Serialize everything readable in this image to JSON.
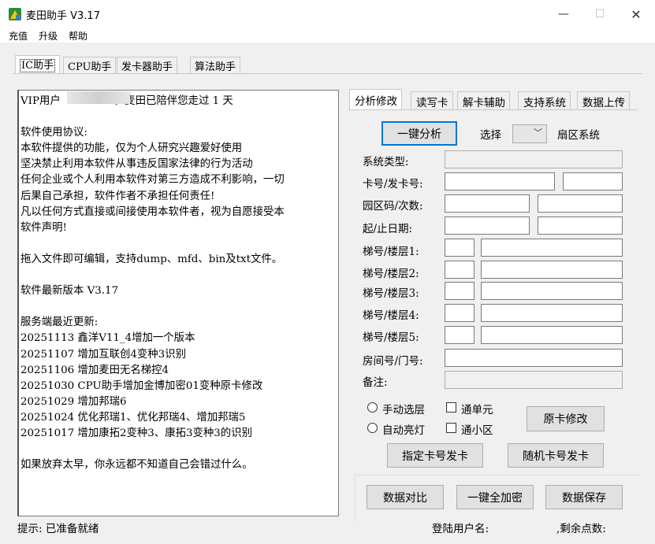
{
  "window": {
    "title": "麦田助手 V3.17",
    "minimize": "—",
    "maximize": "☐",
    "close": "✕"
  },
  "menu": [
    "充值",
    "升级",
    "帮助"
  ],
  "tabs": [
    "IC助手",
    "CPU助手",
    "发卡器助手",
    "算法助手"
  ],
  "info_lines": [
    "VIP用户                ，麦田已陪伴您走过 1 天",
    "",
    "软件使用协议:",
    "本软件提供的功能，仅为个人研究兴趣爱好使用",
    "坚决禁止利用本软件从事违反国家法律的行为活动",
    "任何企业或个人利用本软件对第三方造成不利影响，一切",
    "后果自己承担，软件作者不承担任何责任!",
    "凡以任何方式直接或间接使用本软件者，视为自愿接受本",
    "软件声明!",
    "",
    "拖入文件即可编辑，支持dump、mfd、bin及txt文件。",
    "",
    "软件最新版本 V3.17",
    "",
    "服务端最近更新:",
    "20251113 鑫洋V11_4增加一个版本",
    "20251107 增加互联创4变种3识别",
    "20251106 增加麦田无名梯控4",
    "20251030 CPU助手增加金博加密01变种原卡修改",
    "20251029 增加邦瑞6",
    "20251024 优化邦瑞1、优化邦瑞4、增加邦瑞5",
    "20251017 增加康拓2变种3、康拓3变种3的识别",
    "",
    "如果放弃太早，你永远都不知道自己会错过什么。"
  ],
  "subtabs": [
    "分析修改",
    "读写卡",
    "解卡辅助",
    "支持系统",
    "数据上传"
  ],
  "analysis": {
    "one_click": "一键分析",
    "select_label": "选择",
    "sector_label": "扇区系统",
    "fields": {
      "system_type": "系统类型:",
      "card_no": "卡号/发卡号:",
      "park_code": "园区码/次数:",
      "date_range": "起/止日期:",
      "floor1": "梯号/楼层1:",
      "floor2": "梯号/楼层2:",
      "floor3": "梯号/楼层3:",
      "floor4": "梯号/楼层4:",
      "floor5": "梯号/楼层5:",
      "room": "房间号/门号:",
      "remark": "备注:"
    },
    "radio_manual": "手动选层",
    "radio_auto": "自动亮灯",
    "check_single": "通单元",
    "check_district": "通小区",
    "btn_modify": "原卡修改",
    "btn_assign": "指定卡号发卡",
    "btn_random": "随机卡号发卡",
    "btn_compare": "数据对比",
    "btn_encrypt": "一键全加密",
    "btn_save": "数据保存"
  },
  "status": {
    "hint": "提示: 已准备就绪",
    "login": "登陆用户名:",
    "points": ",剩余点数:"
  }
}
